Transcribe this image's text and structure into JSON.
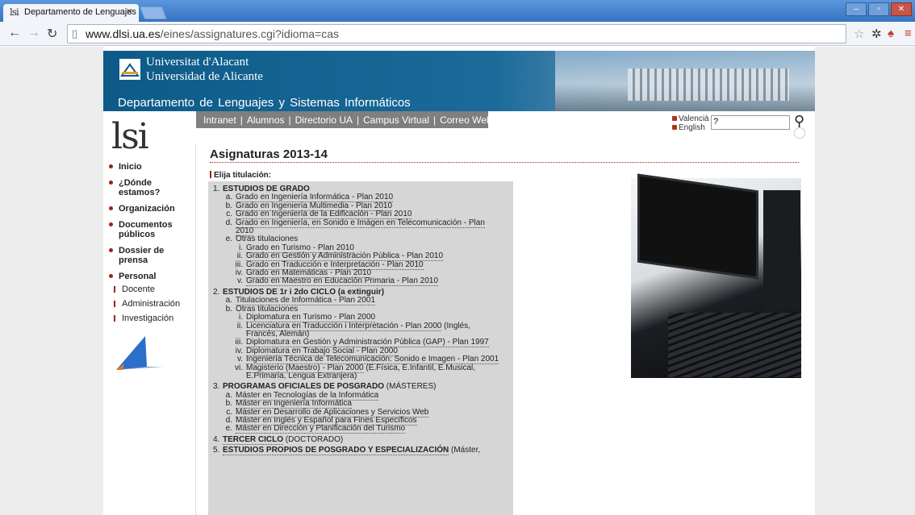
{
  "browser": {
    "tab_title": "Departamento de Lenguajes",
    "tab_favicon": "lsi",
    "url_domain": "www.dlsi.ua.es",
    "url_path": "/eines/assignatures.cgi?idioma=cas"
  },
  "header": {
    "university_line1": "Universitat d'Alacant",
    "university_line2": "Universidad de Alicante",
    "department": "Departamento de Lenguajes y Sistemas Informáticos",
    "topnav": [
      "Intranet",
      "Alumnos",
      "Directorio UA",
      "Campus Virtual",
      "Correo Web"
    ],
    "lang": [
      "Valencià",
      "English"
    ],
    "search_value": "?"
  },
  "sidebar": {
    "logo": "lsi",
    "items": [
      {
        "label": "Inicio"
      },
      {
        "label": "¿Dónde estamos?"
      },
      {
        "label": "Organización"
      },
      {
        "label": "Documentos públicos"
      },
      {
        "label": "Dossier de prensa"
      },
      {
        "label": "Personal"
      }
    ],
    "personal_sub": [
      "Docente",
      "Administración",
      "Investigación"
    ]
  },
  "main": {
    "title": "Asignaturas 2013-14",
    "choose_label": "Elija titulación:",
    "sections": [
      {
        "num": "1.",
        "title": "ESTUDIOS DE GRADO",
        "rest": ""
      },
      {
        "num": "2.",
        "title": "ESTUDIOS DE 1r i 2do CICLO (a extinguir)",
        "rest": ""
      },
      {
        "num": "3.",
        "title": "PROGRAMAS OFICIALES DE POSGRADO",
        "rest": " (MÁSTERES)"
      },
      {
        "num": "4.",
        "title": "TERCER CICLO",
        "rest": " (DOCTORADO)"
      },
      {
        "num": "5.",
        "title": "ESTUDIOS PROPIOS DE POSGRADO Y ESPECIALIZACIÓN",
        "rest": " (Máster,"
      }
    ],
    "grado": [
      {
        "n": "a.",
        "t": "Grado en Ingeniería Informática - Plan 2010"
      },
      {
        "n": "b.",
        "t": "Grado en Ingeniería Multimedia - Plan 2010"
      },
      {
        "n": "c.",
        "t": "Grado en Ingeniería de la Edificación - Plan 2010"
      },
      {
        "n": "d.",
        "t": "Grado en Ingeniería, en Sonido e Imágen en Telecomunicación - Plan",
        "t2": "2010"
      },
      {
        "n": "e.",
        "t": "Otras titulaciones"
      }
    ],
    "grado_otras": [
      {
        "n": "i.",
        "t": "Grado en Turismo - Plan 2010"
      },
      {
        "n": "ii.",
        "t": "Grado en Gestión y Administración Pública - Plan 2010"
      },
      {
        "n": "iii.",
        "t": "Grado en Traducción e Interpretación - Plan 2010"
      },
      {
        "n": "iv.",
        "t": "Grado en Matemáticas - Plan 2010"
      },
      {
        "n": "v.",
        "t": "Grado en Maestro en Educación Primaria - Plan 2010"
      }
    ],
    "ciclo": [
      {
        "n": "a.",
        "t": "Titulaciones de Informática - Plan 2001"
      },
      {
        "n": "b.",
        "t": "Otras titulaciones"
      }
    ],
    "ciclo_otras": [
      {
        "n": "i.",
        "t": "Diplomatura en Turismo - Plan 2000",
        "r": ""
      },
      {
        "n": "ii.",
        "t": "Licenciatura en Traducción i Interpretación - Plan 2000",
        "r": " (Inglés,",
        "r2": "Francés, Alemán)"
      },
      {
        "n": "iii.",
        "t": "Diplomatura en Gestión y Administración Pública (GAP) - Plan 1997",
        "r": ""
      },
      {
        "n": "iv.",
        "t": "Diplomatura en Trabajo Social - Plan 2000",
        "r": ""
      },
      {
        "n": "v.",
        "t": "Ingeniería Técnica de Telecomunicación: Sonido e Imagen - Plan 2001",
        "r": ""
      },
      {
        "n": "vi.",
        "t": "Magisterio (Maestro) - Plan 2000",
        "r": " (E.Física, E.Infantil, E.Musical,",
        "r2": "E.Primaria, Lengua Extranjera)"
      }
    ],
    "master": [
      {
        "n": "a.",
        "t": "Máster en Tecnologías de la Informática"
      },
      {
        "n": "b.",
        "t": "Máster en Ingeniería Informática"
      },
      {
        "n": "c.",
        "t": "Máster en Desarrollo de Aplicaciones y Servicios Web"
      },
      {
        "n": "d.",
        "t": "Máster en Inglés y Español para Fines Específicos"
      },
      {
        "n": "e.",
        "t": "Máster en Dirección y Planificación del Turismo"
      }
    ]
  }
}
